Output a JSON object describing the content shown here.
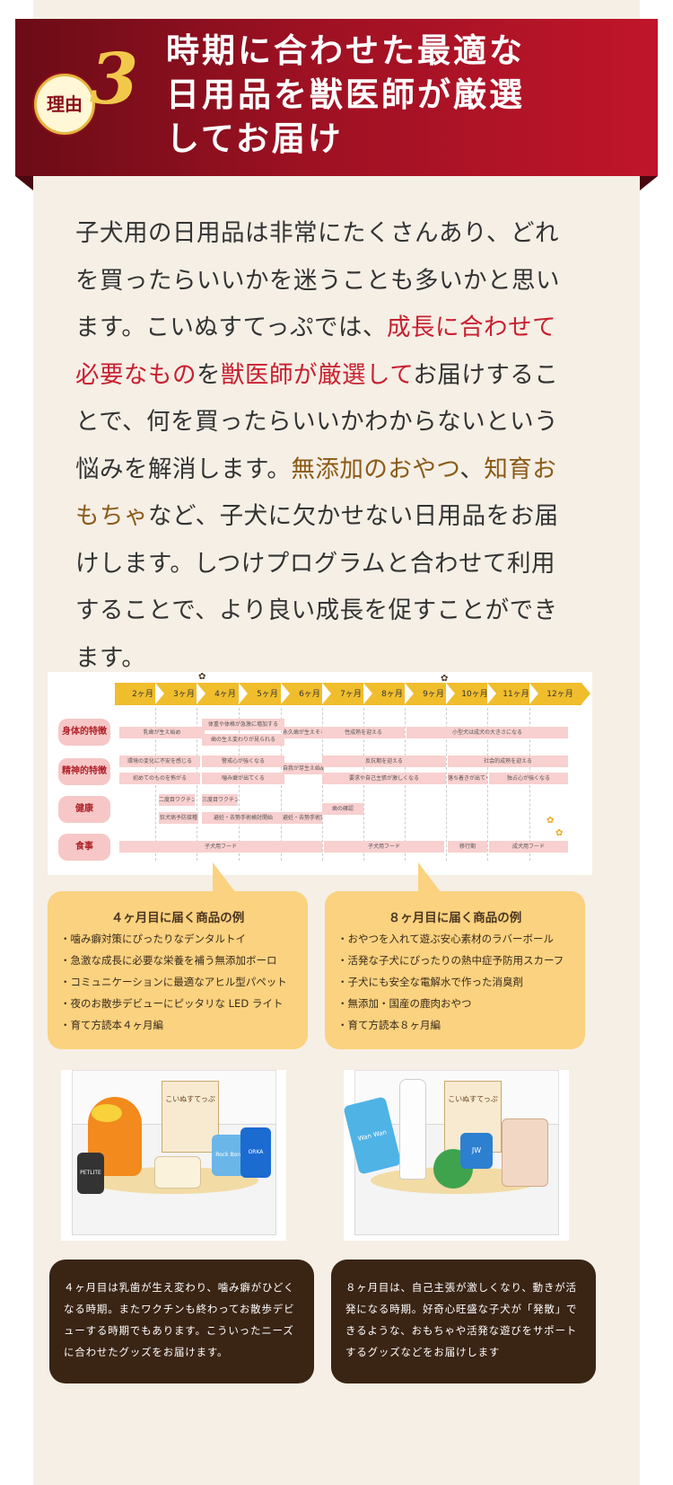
{
  "header": {
    "badge_label": "理由",
    "badge_number": "3",
    "title_lines": [
      "時期に合わせた最適な",
      "日用品を獣医師が厳選",
      "してお届け"
    ]
  },
  "body": {
    "p1": "子犬用の日用品は非常にたくさんあり、どれを買ったらいいかを迷うことも多いかと思います。こいぬすてっぷでは、",
    "h1": "成長に合わせて必要なもの",
    "p2": "を",
    "h2": "獣医師が厳選して",
    "p3": "お届けすることで、何を買ったらいいかわからないという悩みを解消します。",
    "h3": "無添加のおやつ",
    "p4": "、",
    "h4": "知育おもちゃ",
    "p5": "など、子犬に欠かせない日用品をお届けします。しつけプログラムと合わせて利用することで、より良い成長を促すことができます。"
  },
  "timeline": {
    "months": [
      "2ヶ月",
      "3ヶ月",
      "4ヶ月",
      "5ヶ月",
      "6ヶ月",
      "7ヶ月",
      "8ヶ月",
      "9ヶ月",
      "10ヶ月",
      "11ヶ月",
      "12ヶ月"
    ],
    "rows": [
      "身体的特徴",
      "精神的特徴",
      "健康",
      "食事"
    ],
    "segments": {
      "s1": "乳歯が生え始め",
      "s2": "体重や体格が急激に増加する",
      "s3": "歯の生え変わりが見られる",
      "s4": "永久歯が生えそろう",
      "s5": "性成熟を迎える",
      "s6": "小型犬は成犬の大きさになる",
      "s7": "環境の変化に不安を感じる",
      "s8": "警戒心が強くなる",
      "s9": "自我が芽生え始める",
      "s10": "反抗期を迎える",
      "s11": "社会的成熟を迎える",
      "s12": "初めてのものを怖がる",
      "s13": "噛み癖が出てくる",
      "s14": "要求や自己主張が激しくなる",
      "s15": "落ち着きが出てくる",
      "s16": "独占心が強くなる",
      "s17": "二度目ワクチン接種",
      "s18": "三度目ワクチン接種",
      "s19": "狂犬病予防接種",
      "s20": "避妊・去勢手術検討開始",
      "s21": "避妊・去勢手術実施",
      "s22": "歯の確認",
      "s23": "子犬用フード",
      "s24": "子犬用フード",
      "s25": "移行期",
      "s26": "成犬用フード"
    }
  },
  "bubbles": [
    {
      "title": "４ヶ月目に届く商品の例",
      "items": [
        "・噛み癖対策にぴったりなデンタルトイ",
        "・急激な成長に必要な栄養を補う無添加ボーロ",
        "・コミュニケーションに最適なアヒル型パペット",
        "・夜のお散歩デビューにピッタリな LED ライト",
        "・育て方読本４ヶ月編"
      ]
    },
    {
      "title": "８ヶ月目に届く商品の例",
      "items": [
        "・おやつを入れて遊ぶ安心素材のラバーボール",
        "・活発な子犬にぴったりの熱中症予防用スカーフ",
        "・子犬にも安全な電解水で作った消臭剤",
        "・無添加・国産の鹿肉おやつ",
        "・育て方読本８ヶ月編"
      ]
    }
  ],
  "boxes": {
    "card_label": "こいぬすてっぷ",
    "left_labels": [
      "PETLITE",
      "Rock Bone",
      "ORKA"
    ],
    "right_labels": [
      "Wan Wan",
      "JW"
    ]
  },
  "captions": [
    "４ヶ月目は乳歯が生え変わり、噛み癖がひどくなる時期。またワクチンも終わってお散歩デビューする時期でもあります。こういったニーズに合わせたグッズをお届けます。",
    "８ヶ月目は、自己主張が激しくなり、動きが活発になる時期。好奇心旺盛な子犬が「発散」できるような、おもちゃや活発な遊びをサポートするグッズなどをお届けします"
  ],
  "colors": {
    "ribbon": "#9d1123",
    "accent_red": "#c8202f",
    "accent_brown": "#8b5a16",
    "bubble": "#fbd27f",
    "caption_bg": "#3a2414",
    "timeline_bar": "#f0bd2d"
  }
}
